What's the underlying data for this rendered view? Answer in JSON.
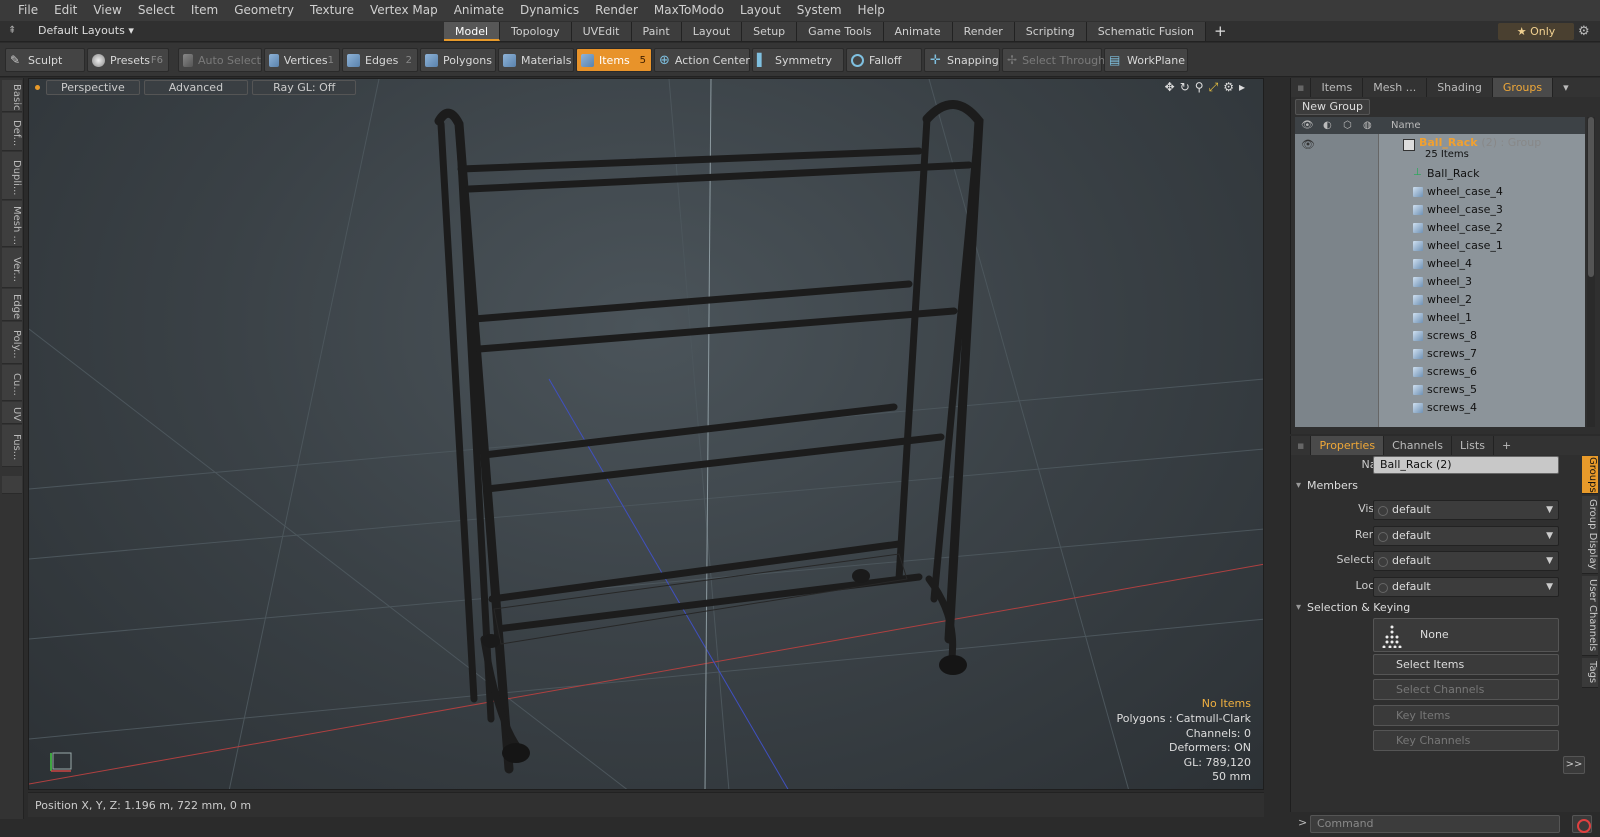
{
  "menu": [
    "File",
    "Edit",
    "View",
    "Select",
    "Item",
    "Geometry",
    "Texture",
    "Vertex Map",
    "Animate",
    "Dynamics",
    "Render",
    "MaxToModo",
    "Layout",
    "System",
    "Help"
  ],
  "layout_selector": "Default Layouts",
  "tabs": [
    "Model",
    "Topology",
    "UVEdit",
    "Paint",
    "Layout",
    "Setup",
    "Game Tools",
    "Animate",
    "Render",
    "Scripting",
    "Schematic Fusion"
  ],
  "active_tab": "Model",
  "only_label": "Only",
  "toolbar": {
    "sculpt": "Sculpt",
    "presets": "Presets",
    "presets_key": "F6",
    "auto_select": "Auto Select",
    "vertices": "Vertices",
    "vertices_key": "1",
    "edges": "Edges",
    "edges_key": "2",
    "polygons": "Polygons",
    "materials": "Materials",
    "items": "Items",
    "items_key": "5",
    "action_center": "Action Center",
    "symmetry": "Symmetry",
    "falloff": "Falloff",
    "snapping": "Snapping",
    "select_through": "Select Through",
    "workplane": "WorkPlane"
  },
  "left_tabs": [
    "Basic",
    "Def...",
    "Dupli...",
    "Mesh ...",
    "Ver...",
    "Edge",
    "Poly...",
    "Cu...",
    "UV",
    "Fus..."
  ],
  "viewport": {
    "view_mode": "Perspective",
    "shading": "Advanced",
    "raygl": "Ray GL: Off",
    "info": {
      "no_items": "No Items",
      "polygons": "Polygons : Catmull-Clark",
      "channels": "Channels: 0",
      "deformers": "Deformers: ON",
      "gl": "GL: 789,120",
      "scale": "50 mm"
    }
  },
  "status": "Position X, Y, Z:   1.196 m, 722 mm, 0 m",
  "right_top": {
    "tabs": [
      "Items",
      "Mesh ...",
      "Shading",
      "Groups"
    ],
    "active_tab": "Groups",
    "new_group": "New Group",
    "col_name": "Name",
    "group": {
      "name": "Ball_Rack",
      "suffix": "(2) : Group",
      "count": "25 Items"
    },
    "items": [
      "Ball_Rack",
      "wheel_case_4",
      "wheel_case_3",
      "wheel_case_2",
      "wheel_case_1",
      "wheel_4",
      "wheel_3",
      "wheel_2",
      "wheel_1",
      "screws_8",
      "screws_7",
      "screws_6",
      "screws_5",
      "screws_4"
    ]
  },
  "properties": {
    "tabs": [
      "Properties",
      "Channels",
      "Lists"
    ],
    "active_tab": "Properties",
    "name_label": "Name",
    "name_value": "Ball_Rack (2)",
    "members_label": "Members",
    "visible_label": "Visible",
    "visible_value": "default",
    "render_label": "Render",
    "render_value": "default",
    "selectable_label": "Selectable",
    "selectable_value": "default",
    "locked_label": "Locked",
    "locked_value": "default",
    "selkey_label": "Selection & Keying",
    "none_label": "None",
    "select_items": "Select Items",
    "select_channels": "Select Channels",
    "key_items": "Key Items",
    "key_channels": "Key Channels",
    "more": ">>",
    "side_tabs": [
      "Groups",
      "Group Display",
      "User Channels",
      "Tags"
    ]
  },
  "command_placeholder": "Command",
  "colors": {
    "accent": "#e8932a",
    "group_name": "#f0a030"
  }
}
